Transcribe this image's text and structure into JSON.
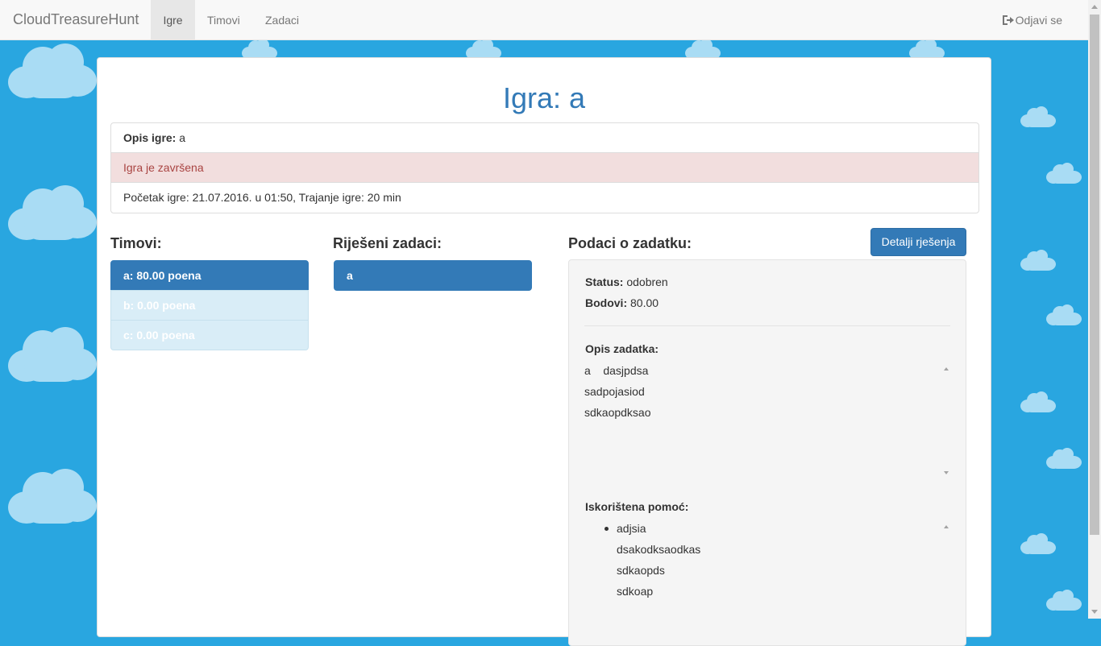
{
  "navbar": {
    "brand": "CloudTreasureHunt",
    "items": [
      {
        "label": "Igre",
        "active": true
      },
      {
        "label": "Timovi",
        "active": false
      },
      {
        "label": "Zadaci",
        "active": false
      }
    ],
    "logout_label": "Odjavi se",
    "logout_icon": "sign-out-icon"
  },
  "page": {
    "title": "Igra: a"
  },
  "game_info": {
    "desc_label": "Opis igre:",
    "desc_value": "a",
    "status_text": "Igra je završena",
    "timing_text": "Početak igre: 21.07.2016. u 01:50, Trajanje igre: 20 min"
  },
  "teams": {
    "heading": "Timovi:",
    "items": [
      {
        "label": "a: 80.00 poena",
        "state": "active"
      },
      {
        "label": "b: 0.00 poena",
        "state": "info"
      },
      {
        "label": "c: 0.00 poena",
        "state": "info"
      }
    ]
  },
  "solved": {
    "heading": "Riješeni zadaci:",
    "items": [
      {
        "label": "a",
        "state": "active"
      }
    ]
  },
  "task": {
    "heading": "Podaci o zadatku:",
    "details_button": "Detalji rješenja",
    "status_label": "Status:",
    "status_value": "odobren",
    "points_label": "Bodovi:",
    "points_value": "80.00",
    "desc_label": "Opis zadatka:",
    "desc_lines": [
      "a    dasjpdsa",
      "sadpojasiod",
      "sdkaopdksao"
    ],
    "help_label": "Iskorištena pomoć:",
    "help_lines": [
      "adjsia",
      "dsakodksaodkas",
      "sdkaopds",
      "sdkoap"
    ]
  },
  "colors": {
    "background": "#29a6e0",
    "cloud": "#a9dcf4",
    "primary": "#337ab7",
    "danger_bg": "#f2dede",
    "danger_text": "#a94442",
    "info_bg": "#d9edf7"
  }
}
